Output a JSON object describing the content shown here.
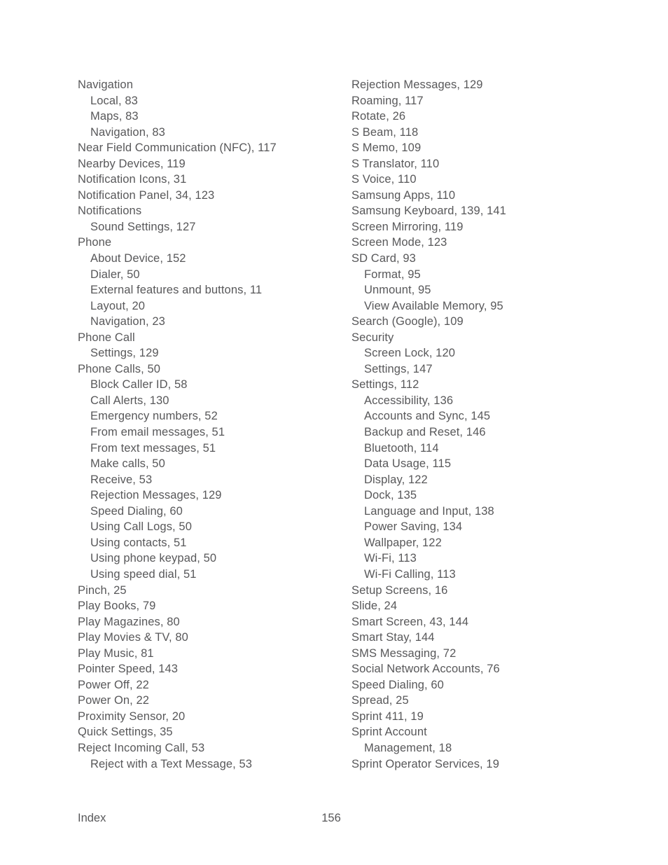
{
  "document": {
    "section_title": "Index",
    "page_number": "156",
    "text_color": "#58585a",
    "background_color": "#ffffff"
  },
  "columns": {
    "left": [
      {
        "text": "Navigation",
        "level": 0
      },
      {
        "text": "Local, 83",
        "level": 1
      },
      {
        "text": "Maps, 83",
        "level": 1
      },
      {
        "text": "Navigation, 83",
        "level": 1
      },
      {
        "text": "Near Field Communication (NFC), 117",
        "level": 0
      },
      {
        "text": "Nearby Devices, 119",
        "level": 0
      },
      {
        "text": "Notification Icons, 31",
        "level": 0
      },
      {
        "text": "Notification Panel, 34, 123",
        "level": 0
      },
      {
        "text": "Notifications",
        "level": 0
      },
      {
        "text": "Sound Settings, 127",
        "level": 1
      },
      {
        "text": "Phone",
        "level": 0
      },
      {
        "text": "About Device, 152",
        "level": 1
      },
      {
        "text": "Dialer, 50",
        "level": 1
      },
      {
        "text": "External features and buttons, 11",
        "level": 1
      },
      {
        "text": "Layout, 20",
        "level": 1
      },
      {
        "text": "Navigation, 23",
        "level": 1
      },
      {
        "text": "Phone Call",
        "level": 0
      },
      {
        "text": "Settings, 129",
        "level": 1
      },
      {
        "text": "Phone Calls, 50",
        "level": 0
      },
      {
        "text": "Block Caller ID, 58",
        "level": 1
      },
      {
        "text": "Call Alerts, 130",
        "level": 1
      },
      {
        "text": "Emergency numbers, 52",
        "level": 1
      },
      {
        "text": "From email messages, 51",
        "level": 1
      },
      {
        "text": "From text messages, 51",
        "level": 1
      },
      {
        "text": "Make calls, 50",
        "level": 1
      },
      {
        "text": "Receive, 53",
        "level": 1
      },
      {
        "text": "Rejection Messages, 129",
        "level": 1
      },
      {
        "text": "Speed Dialing, 60",
        "level": 1
      },
      {
        "text": "Using Call Logs, 50",
        "level": 1
      },
      {
        "text": "Using contacts, 51",
        "level": 1
      },
      {
        "text": "Using phone keypad, 50",
        "level": 1
      },
      {
        "text": "Using speed dial, 51",
        "level": 1
      },
      {
        "text": "Pinch, 25",
        "level": 0
      },
      {
        "text": "Play Books, 79",
        "level": 0
      },
      {
        "text": "Play Magazines, 80",
        "level": 0
      },
      {
        "text": "Play Movies & TV, 80",
        "level": 0
      },
      {
        "text": "Play Music, 81",
        "level": 0
      },
      {
        "text": "Pointer Speed, 143",
        "level": 0
      },
      {
        "text": "Power Off, 22",
        "level": 0
      },
      {
        "text": "Power On, 22",
        "level": 0
      },
      {
        "text": "Proximity Sensor, 20",
        "level": 0
      },
      {
        "text": "Quick Settings, 35",
        "level": 0
      },
      {
        "text": "Reject Incoming Call, 53",
        "level": 0
      },
      {
        "text": "Reject with a Text Message, 53",
        "level": 1
      }
    ],
    "right": [
      {
        "text": "Rejection Messages, 129",
        "level": 0
      },
      {
        "text": "Roaming, 117",
        "level": 0
      },
      {
        "text": "Rotate, 26",
        "level": 0
      },
      {
        "text": "S Beam, 118",
        "level": 0
      },
      {
        "text": "S Memo, 109",
        "level": 0
      },
      {
        "text": "S Translator, 110",
        "level": 0
      },
      {
        "text": "S Voice, 110",
        "level": 0
      },
      {
        "text": "Samsung Apps, 110",
        "level": 0
      },
      {
        "text": "Samsung Keyboard, 139, 141",
        "level": 0
      },
      {
        "text": "Screen Mirroring, 119",
        "level": 0
      },
      {
        "text": "Screen Mode, 123",
        "level": 0
      },
      {
        "text": "SD Card, 93",
        "level": 0
      },
      {
        "text": "Format, 95",
        "level": 1
      },
      {
        "text": "Unmount, 95",
        "level": 1
      },
      {
        "text": "View Available Memory, 95",
        "level": 1
      },
      {
        "text": "Search (Google), 109",
        "level": 0
      },
      {
        "text": "Security",
        "level": 0
      },
      {
        "text": "Screen Lock, 120",
        "level": 1
      },
      {
        "text": "Settings, 147",
        "level": 1
      },
      {
        "text": "Settings, 112",
        "level": 0
      },
      {
        "text": "Accessibility, 136",
        "level": 1
      },
      {
        "text": "Accounts and Sync, 145",
        "level": 1
      },
      {
        "text": "Backup and Reset, 146",
        "level": 1
      },
      {
        "text": "Bluetooth, 114",
        "level": 1
      },
      {
        "text": "Data Usage, 115",
        "level": 1
      },
      {
        "text": "Display, 122",
        "level": 1
      },
      {
        "text": "Dock, 135",
        "level": 1
      },
      {
        "text": "Language and Input, 138",
        "level": 1
      },
      {
        "text": "Power Saving, 134",
        "level": 1
      },
      {
        "text": "Wallpaper, 122",
        "level": 1
      },
      {
        "text": "Wi-Fi, 113",
        "level": 1
      },
      {
        "text": "Wi-Fi Calling, 113",
        "level": 1
      },
      {
        "text": "Setup Screens, 16",
        "level": 0
      },
      {
        "text": "Slide, 24",
        "level": 0
      },
      {
        "text": "Smart Screen, 43, 144",
        "level": 0
      },
      {
        "text": "Smart Stay, 144",
        "level": 0
      },
      {
        "text": "SMS Messaging, 72",
        "level": 0
      },
      {
        "text": "Social Network Accounts, 76",
        "level": 0
      },
      {
        "text": "Speed Dialing, 60",
        "level": 0
      },
      {
        "text": "Spread, 25",
        "level": 0
      },
      {
        "text": "Sprint 411, 19",
        "level": 0
      },
      {
        "text": "Sprint Account",
        "level": 0
      },
      {
        "text": "Management, 18",
        "level": 1
      },
      {
        "text": "Sprint Operator Services, 19",
        "level": 0
      }
    ]
  }
}
